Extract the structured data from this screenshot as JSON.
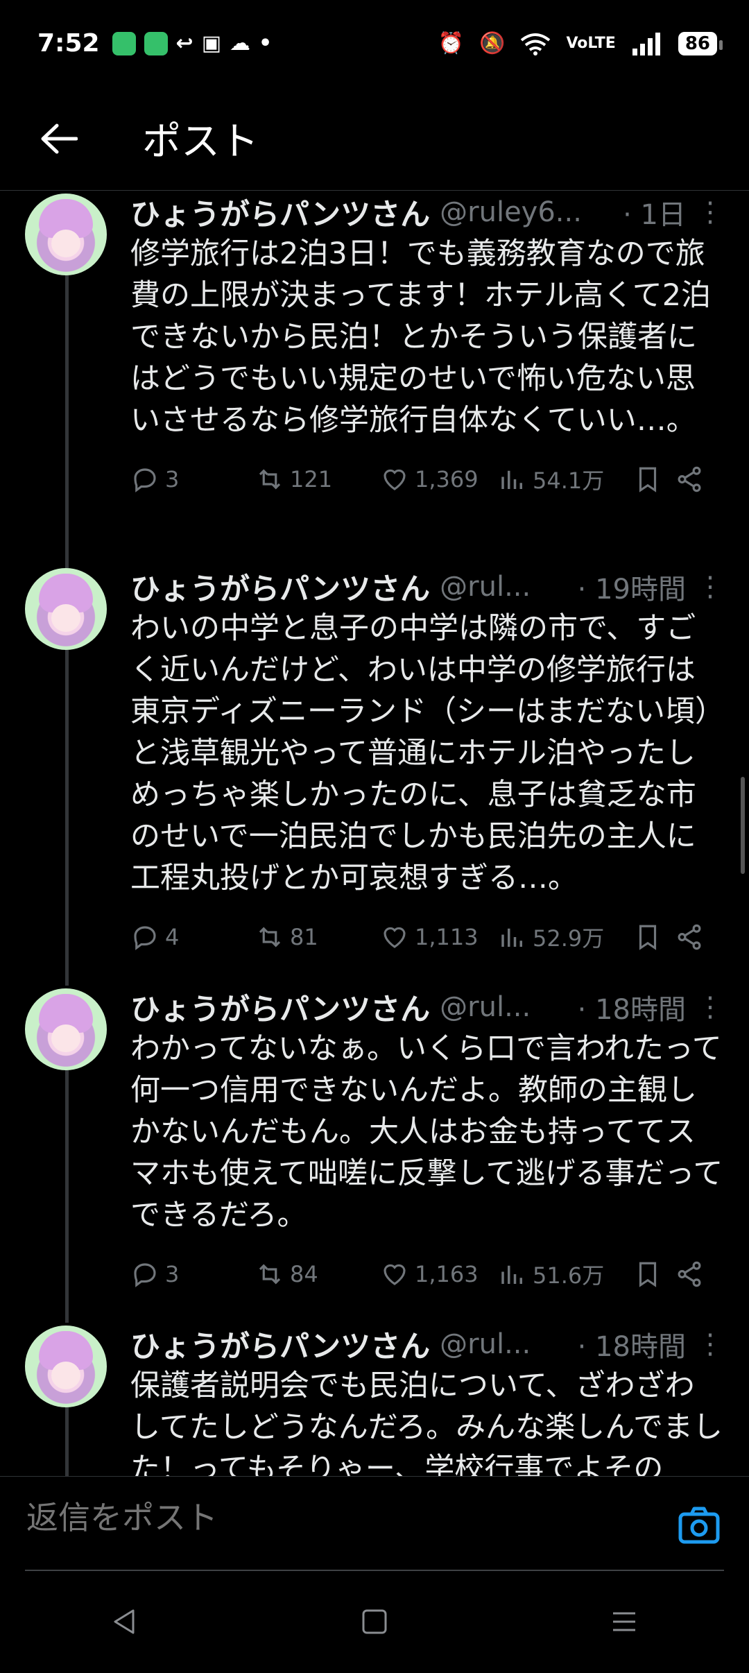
{
  "status_bar": {
    "time": "7:52",
    "battery": "86",
    "left_icons": [
      "app-icon-1",
      "app-icon-2",
      "reply-arrow-icon",
      "calendar-icon",
      "cloud-icon",
      "dot-icon"
    ],
    "right_icons": [
      "alarm-icon",
      "mute-icon",
      "wifi-icon",
      "volte-icon",
      "signal-icon"
    ]
  },
  "header": {
    "title": "ポスト"
  },
  "tweets": [
    {
      "name": "ひょうがらパンツさん",
      "handle": "@ruley6...",
      "time": "· 1日",
      "text": "修学旅行は2泊3日！でも義務教育なので旅費の上限が決まってます！ホテル高くて2泊できないから民泊！とかそういう保護者にはどうでもいい規定のせいで怖い危ない思いさせるなら修学旅行自体なくていい…。",
      "replies": "3",
      "reposts": "121",
      "likes": "1,369",
      "views": "54.1万"
    },
    {
      "name": "ひょうがらパンツさん",
      "handle": "@rul...",
      "time": "· 19時間",
      "text": "わいの中学と息子の中学は隣の市で、すごく近いんだけど、わいは中学の修学旅行は東京ディズニーランド（シーはまだない頃）と浅草観光やって普通にホテル泊やったしめっちゃ楽しかったのに、息子は貧乏な市のせいで一泊民泊でしかも民泊先の主人に工程丸投げとか可哀想すぎる…。",
      "replies": "4",
      "reposts": "81",
      "likes": "1,113",
      "views": "52.9万"
    },
    {
      "name": "ひょうがらパンツさん",
      "handle": "@rul...",
      "time": "· 18時間",
      "text": "わかってないなぁ。いくら口で言われたって何一つ信用できないんだよ。教師の主観しかないんだもん。大人はお金も持っててスマホも使えて咄嗟に反撃して逃げる事だってできるだろ。",
      "replies": "3",
      "reposts": "84",
      "likes": "1,163",
      "views": "51.6万"
    },
    {
      "name": "ひょうがらパンツさん",
      "handle": "@rul...",
      "time": "· 18時間",
      "text": "保護者説明会でも民泊について、ざわざわしてたしどうなんだろ。みんな楽しんでました！ってもそりゃー、学校行事でよその"
    }
  ],
  "reply_bar": {
    "placeholder": "返信をポスト"
  },
  "nav": [
    "back-nav",
    "home-nav",
    "recents-nav"
  ],
  "colors": {
    "background": "#000000",
    "text": "#e7e9ea",
    "muted": "#71767b",
    "accent": "#1d9bf0"
  }
}
